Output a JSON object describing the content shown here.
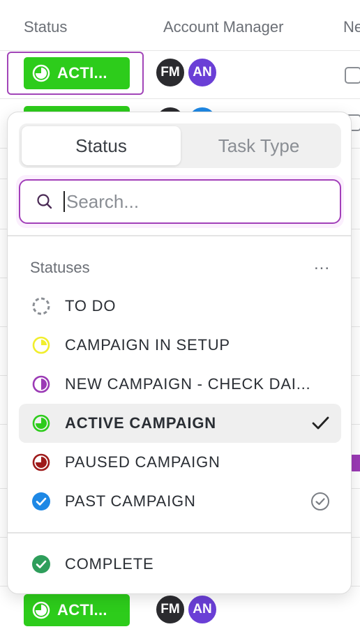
{
  "table": {
    "headers": {
      "status": "Status",
      "account_manager": "Account Manager",
      "next": "Ne"
    },
    "rows": [
      {
        "status_label": "ACTI...",
        "avatars": [
          "FM",
          "AN"
        ]
      },
      {
        "status_label": "",
        "avatars": [
          "",
          ""
        ]
      },
      {
        "status_label": "ACTI...",
        "avatars": [
          "FM",
          "AN"
        ]
      }
    ]
  },
  "dropdown": {
    "tabs": [
      {
        "label": "Status",
        "active": true
      },
      {
        "label": "Task Type",
        "active": false
      }
    ],
    "search": {
      "placeholder": "Search...",
      "value": ""
    },
    "section_title": "Statuses",
    "more_label": "...",
    "statuses": [
      {
        "label": "TO DO",
        "icon": "dashed-circle-icon",
        "color": "#8a8e94"
      },
      {
        "label": "CAMPAIGN IN SETUP",
        "icon": "quarter-circle-icon",
        "color": "#f1ee2c"
      },
      {
        "label": "NEW CAMPAIGN - CHECK DAI...",
        "icon": "half-circle-icon",
        "color": "#9b3ab5"
      },
      {
        "label": "ACTIVE CAMPAIGN",
        "icon": "three-quarter-circle-icon",
        "color": "#2dcc1b",
        "selected": true
      },
      {
        "label": "PAUSED CAMPAIGN",
        "icon": "three-quarter-circle-icon",
        "color": "#9e1a1a"
      },
      {
        "label": "PAST CAMPAIGN",
        "icon": "check-circle-icon",
        "color": "#1e88e5"
      }
    ],
    "closed_statuses": [
      {
        "label": "COMPLETE",
        "icon": "check-circle-icon",
        "color": "#2e9e5b"
      }
    ]
  }
}
